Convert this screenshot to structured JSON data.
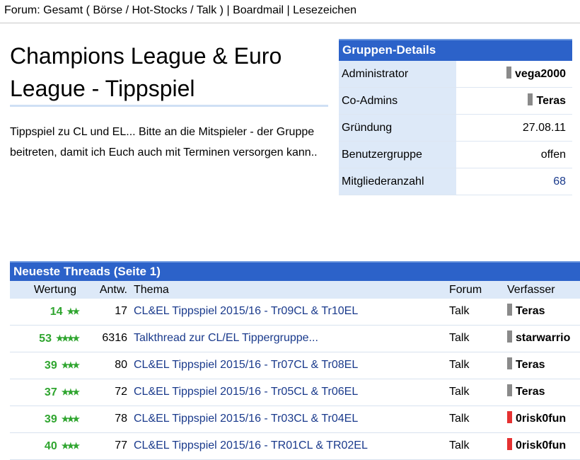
{
  "nav": {
    "text1": "Forum: Gesamt ( Börse / Hot-Stocks / Talk )",
    "sep1": "|",
    "boardmail": "Boardmail",
    "sep2": "|",
    "bookmarks": "Lesezeichen"
  },
  "group": {
    "title": "Champions League & Euro League - Tippspiel",
    "description": "Tippspiel zu CL und EL... Bitte an die Mitspieler - der Gruppe beitreten, damit ich Euch auch mit Terminen versorgen kann.."
  },
  "details": {
    "header": "Gruppen-Details",
    "rows": [
      {
        "label": "Administrator",
        "value": "vega2000"
      },
      {
        "label": "Co-Admins",
        "value": "Teras"
      },
      {
        "label": "Gründung",
        "value": "27.08.11"
      },
      {
        "label": "Benutzergruppe",
        "value": "offen"
      },
      {
        "label": "Mitgliederanzahl",
        "value": "68"
      }
    ]
  },
  "threads": {
    "header": "Neueste Threads (Seite 1)",
    "columns": {
      "rating": "Wertung",
      "answers": "Antw.",
      "topic": "Thema",
      "forum": "Forum",
      "author": "Verfasser"
    },
    "rows": [
      {
        "rating": "14",
        "stars": "★★",
        "answers": "17",
        "topic": "CL&EL Tippspiel 2015/16 - Tr09CL & Tr10EL",
        "forum": "Talk",
        "author": "Teras",
        "author_status": "grey"
      },
      {
        "rating": "53",
        "stars": "★★★★",
        "answers": "6316",
        "topic": "Talkthread zur CL/EL Tippergruppe...",
        "forum": "Talk",
        "author": "starwarrio",
        "author_status": "grey"
      },
      {
        "rating": "39",
        "stars": "★★★",
        "answers": "80",
        "topic": "CL&EL Tippspiel 2015/16 - Tr07CL & Tr08EL",
        "forum": "Talk",
        "author": "Teras",
        "author_status": "grey"
      },
      {
        "rating": "37",
        "stars": "★★★",
        "answers": "72",
        "topic": "CL&EL Tippspiel 2015/16 - Tr05CL & Tr06EL",
        "forum": "Talk",
        "author": "Teras",
        "author_status": "grey"
      },
      {
        "rating": "39",
        "stars": "★★★",
        "answers": "78",
        "topic": "CL&EL Tippspiel 2015/16 - Tr03CL & Tr04EL",
        "forum": "Talk",
        "author": "0risk0fun",
        "author_status": "red"
      },
      {
        "rating": "40",
        "stars": "★★★",
        "answers": "77",
        "topic": "CL&EL Tippspiel 2015/16 - TR01CL & TR02EL",
        "forum": "Talk",
        "author": "0risk0fun",
        "author_status": "red"
      }
    ]
  },
  "colors": {
    "header_bg": "#2c62c9",
    "label_bg": "#dde9f8",
    "link": "#1a3a8c",
    "rating_green": "#2fa52f",
    "status_grey": "#8a8a8a",
    "status_red": "#e53131"
  }
}
